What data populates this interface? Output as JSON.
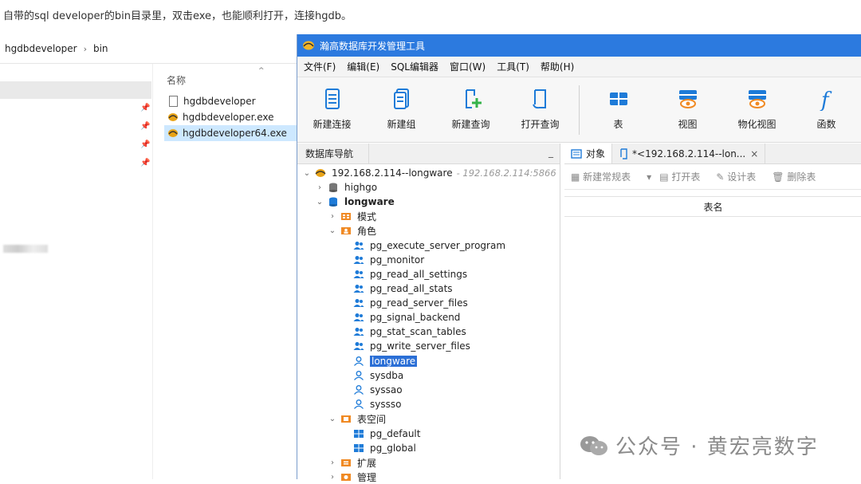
{
  "caption": "自带的sql developer的bin目录里，双击exe，也能顺利打开，连接hgdb。",
  "explorer": {
    "path": [
      "hgdbdeveloper",
      "bin"
    ],
    "column_header": "名称",
    "files": [
      "hgdbdeveloper",
      "hgdbdeveloper.exe",
      "hgdbdeveloper64.exe"
    ]
  },
  "app": {
    "title": "瀚高数据库开发管理工具",
    "menu": [
      "文件(F)",
      "编辑(E)",
      "SQL编辑器",
      "窗口(W)",
      "工具(T)",
      "帮助(H)"
    ],
    "toolbar": [
      "新建连接",
      "新建组",
      "新建查询",
      "打开查询",
      "表",
      "视图",
      "物化视图",
      "函数"
    ],
    "nav_title": "数据库导航",
    "nav_min": "_",
    "tree": {
      "connection": "192.168.2.114--longware",
      "connection_host": "- 192.168.2.114:5866",
      "db_highgo": "highgo",
      "db_longware": "longware",
      "schema": "模式",
      "roles": "角色",
      "role_items": [
        "pg_execute_server_program",
        "pg_monitor",
        "pg_read_all_settings",
        "pg_read_all_stats",
        "pg_read_server_files",
        "pg_signal_backend",
        "pg_stat_scan_tables",
        "pg_write_server_files"
      ],
      "users": [
        "longware",
        "sysdba",
        "syssao",
        "syssso"
      ],
      "tablespace": "表空间",
      "tablespaces": [
        "pg_default",
        "pg_global"
      ],
      "extension": "扩展",
      "manage": "管理"
    },
    "tabs": {
      "objects": "对象",
      "query": "*<192.168.2.114--lon...",
      "close": "×"
    },
    "obj_toolbar": [
      "新建常规表",
      "▾",
      "打开表",
      "设计表",
      "删除表"
    ],
    "table_header": "表名"
  },
  "watermark": "公众号 · 黄宏亮数字"
}
